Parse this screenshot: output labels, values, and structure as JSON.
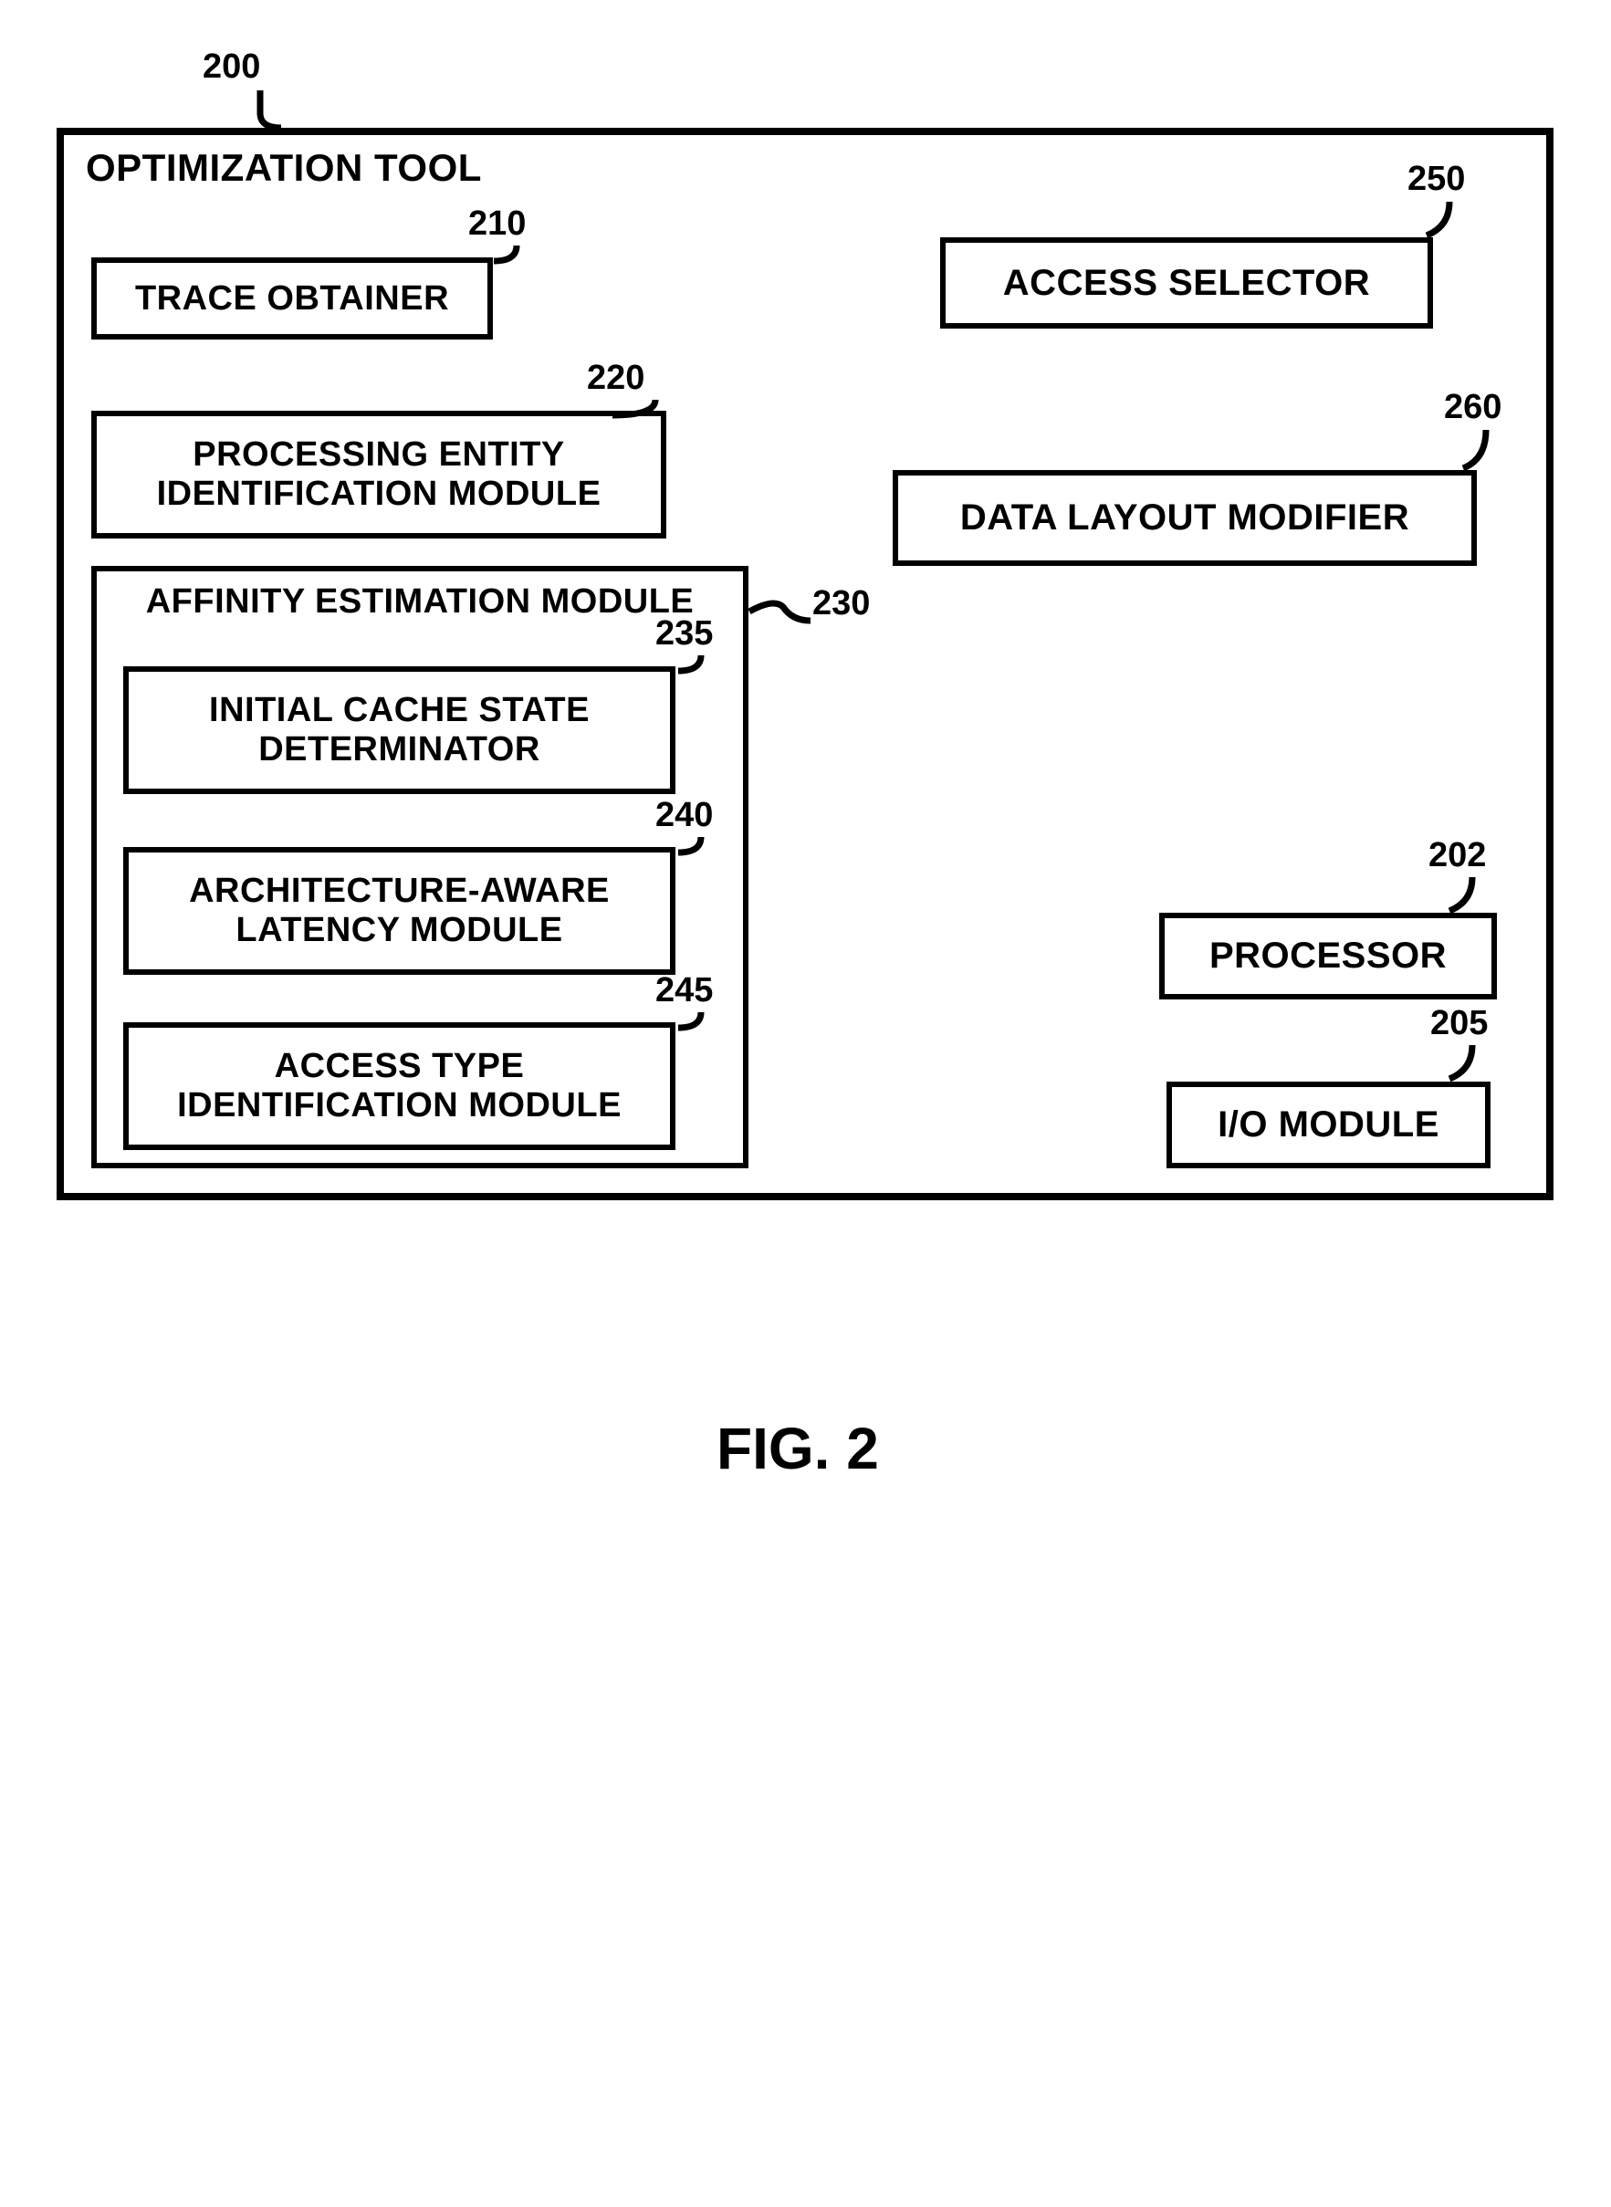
{
  "figure_caption": "FIG. 2",
  "labels": {
    "outer": "OPTIMIZATION TOOL",
    "trace": "TRACE OBTAINER",
    "processing": "PROCESSING ENTITY IDENTIFICATION MODULE",
    "affinity_header": "AFFINITY ESTIMATION MODULE",
    "cache": "INITIAL CACHE STATE DETERMINATOR",
    "arch": "ARCHITECTURE-AWARE LATENCY MODULE",
    "accessType": "ACCESS TYPE IDENTIFICATION MODULE",
    "accessSel": "ACCESS SELECTOR",
    "dataLayout": "DATA LAYOUT MODIFIER",
    "processor": "PROCESSOR",
    "io": "I/O MODULE"
  },
  "numbers": {
    "outer": "200",
    "trace": "210",
    "processing": "220",
    "affinity": "230",
    "cache": "235",
    "arch": "240",
    "accessType": "245",
    "accessSel": "250",
    "dataLayout": "260",
    "processor": "202",
    "io": "205"
  }
}
